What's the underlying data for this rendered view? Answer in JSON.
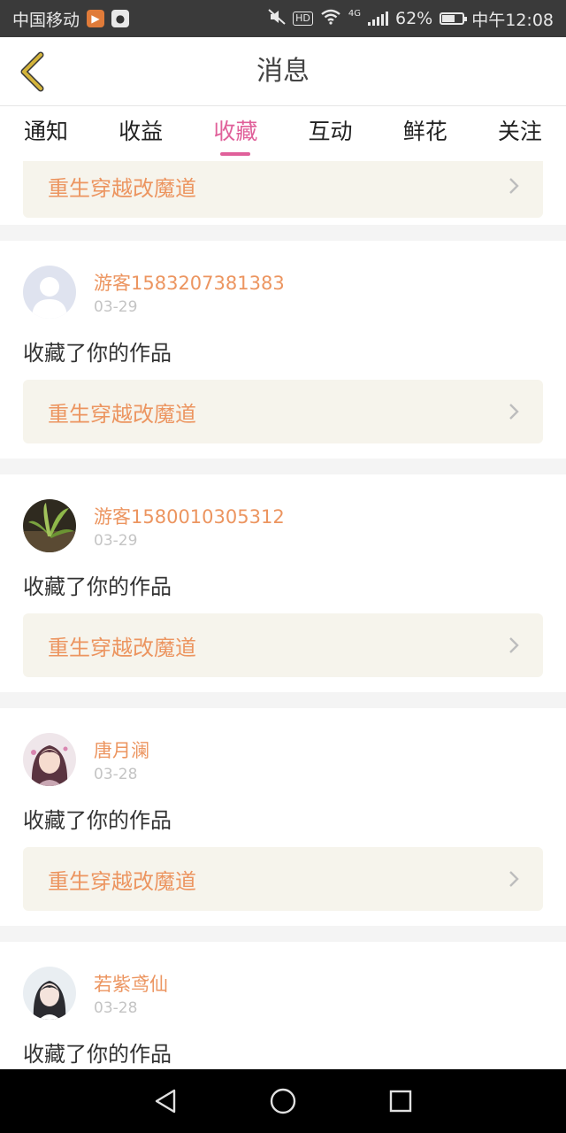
{
  "status_bar": {
    "carrier": "中国移动",
    "hd": "HD",
    "network": "4G",
    "battery": "62%",
    "battery_level": 0.62,
    "time": "中午12:08"
  },
  "header": {
    "title": "消息",
    "back_icon": "chevron-left-icon"
  },
  "tabs": [
    {
      "label": "通知"
    },
    {
      "label": "收益"
    },
    {
      "label": "收藏"
    },
    {
      "label": "互动"
    },
    {
      "label": "鲜花"
    },
    {
      "label": "关注"
    }
  ],
  "active_tab": "收藏",
  "partial_item": {
    "work_title": "重生穿越改魔道"
  },
  "items": [
    {
      "username": "游客1583207381383",
      "date": "03-29",
      "action": "收藏了你的作品",
      "work_title": "重生穿越改魔道",
      "avatar": "default-avatar"
    },
    {
      "username": "游客1580010305312",
      "date": "03-29",
      "action": "收藏了你的作品",
      "work_title": "重生穿越改魔道",
      "avatar": "plant-photo-avatar"
    },
    {
      "username": "唐月澜",
      "date": "03-28",
      "action": "收藏了你的作品",
      "work_title": "重生穿越改魔道",
      "avatar": "anime-girl-avatar"
    },
    {
      "username": "若紫鸢仙",
      "date": "03-28",
      "action": "收藏了你的作品",
      "avatar": "girl-photo-avatar"
    }
  ],
  "colors": {
    "accent": "#e0609a",
    "name": "#ec9560",
    "back_arrow": "#d4b43a"
  },
  "nav_bar": {
    "icons": [
      "back-triangle-icon",
      "home-circle-icon",
      "recents-square-icon"
    ]
  }
}
